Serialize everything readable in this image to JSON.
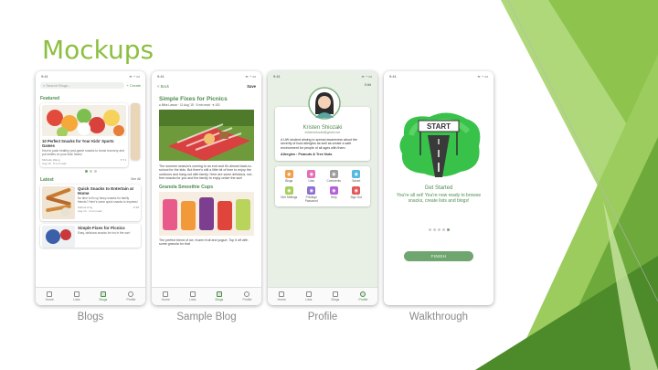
{
  "slide_title": "Mockups",
  "colors": {
    "accent": "#8cbf3f",
    "app_green": "#4f8a4f"
  },
  "status_time": "9:41",
  "tabs": [
    "Home",
    "Lists",
    "Blogs",
    "Profile"
  ],
  "blogs": {
    "caption": "Blogs",
    "search_placeholder": "Search Blogs...",
    "create": "+ Create",
    "featured": "Featured",
    "featured_card": {
      "title": "10 Perfect Snacks for Your Kids' Sports Games",
      "desc": "How to pack healthy post-game snacks to boost recovery and put smiles on your kids' faces!",
      "author": "Michelle Wang",
      "meta": "Aug 15 · 5 min read",
      "likes": "♥ 71"
    },
    "latest": "Latest",
    "see_all": "See All",
    "latest_items": [
      {
        "title": "Quick Snacks to Entertain at Home",
        "desc": "No time to fix up fancy snacks for family friends? Here's some quick snacks to impress!",
        "author": "Sabina King",
        "meta": "Aug 14 · 4 min read",
        "likes": "♥ 28"
      },
      {
        "title": "Simple Fixes for Picnics",
        "desc": "Easy, delicious snacks for fun in the sun!",
        "author": "",
        "meta": "",
        "likes": ""
      }
    ]
  },
  "sample_blog": {
    "caption": "Sample Blog",
    "back": "< Back",
    "save": "Save",
    "title": "Simple Fixes for Picnics",
    "meta": "● Mike Larson  · 11 Aug '15  · 5 min read  · ♥ 102",
    "para1": "The summer season's coming to an end and it's almost back-to-school for the kids. But there's still a little bit of time to enjoy the outdoors and hang out with family. Here are some delicious, nut-free snacks for you and the family to enjoy under the sun!",
    "subhead": "Granola Smoothie Cups",
    "para2": "The perfect blend of ice, frozen fruit and yogurt. Top it off with some granola for that"
  },
  "profile": {
    "caption": "Profile",
    "edit": "Edit",
    "name": "Kristen Shiozaki",
    "email": "kristenshiozaki@gmail.com",
    "bio": "A UW student aiming to spread awareness about the severity of food allergies as well as create a safe environment for people of all ages with them.",
    "allergies_label": "Allergies :",
    "allergies_value": "Peanuts & Tree Nuts",
    "menu": [
      {
        "label": "Blogs",
        "color": "#f0a04b"
      },
      {
        "label": "Lists",
        "color": "#e56fb5"
      },
      {
        "label": "Comments",
        "color": "#9e9e9e"
      },
      {
        "label": "Saved",
        "color": "#57b8e0"
      },
      {
        "label": "Diet Settings",
        "color": "#a9cf5a"
      },
      {
        "label": "Privilege Password",
        "color": "#8e6fd6"
      },
      {
        "label": "Help",
        "color": "#b45fd6"
      },
      {
        "label": "Sign Out",
        "color": "#e05a5a"
      }
    ]
  },
  "walkthrough": {
    "caption": "Walkthrough",
    "sign": "START",
    "heading": "Get Started",
    "body": "You're all set! You're now ready to browse snacks, create lists and blogs!",
    "button": "FINISH",
    "page_index": 5,
    "page_count": 5
  }
}
